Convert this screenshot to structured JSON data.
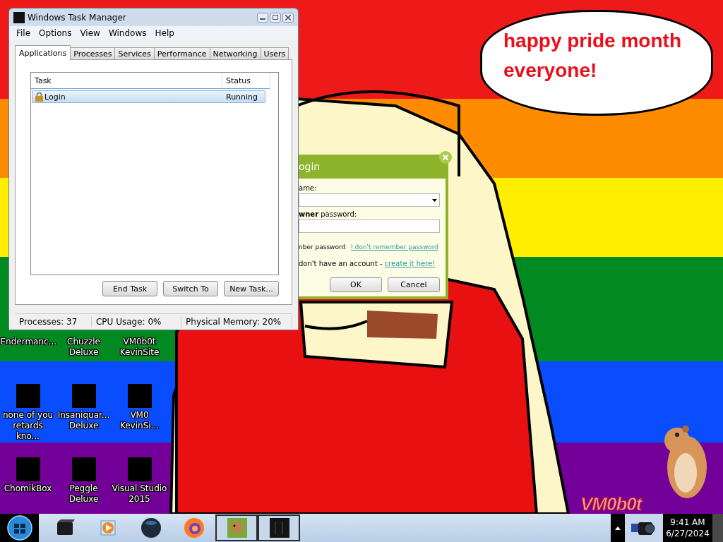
{
  "desktop": {
    "wallpaper": {
      "speech_bubble": "happy pride month everyone!",
      "signature": "VM0b0t"
    },
    "icons": [
      {
        "label": "Endermanc...",
        "kind": "hidden"
      },
      {
        "label": "Chuzzle Deluxe",
        "kind": "hidden"
      },
      {
        "label": "VM0b0t KevinSite",
        "kind": "hidden"
      },
      {
        "label": "none of you retards kno...",
        "kind": "redacted"
      },
      {
        "label": "Insaniquar... Deluxe",
        "kind": "redacted"
      },
      {
        "label": "VM0 KevinSi...",
        "kind": "redacted"
      },
      {
        "label": "ChomikBox",
        "kind": "redacted"
      },
      {
        "label": "Peggle Deluxe",
        "kind": "redacted"
      },
      {
        "label": "Visual Studio 2015",
        "kind": "redacted"
      }
    ]
  },
  "task_manager": {
    "title": "Windows Task Manager",
    "menu": [
      "File",
      "Options",
      "View",
      "Windows",
      "Help"
    ],
    "tabs": [
      {
        "label": "Applications",
        "selected": true
      },
      {
        "label": "Processes",
        "selected": false
      },
      {
        "label": "Services",
        "selected": false
      },
      {
        "label": "Performance",
        "selected": false
      },
      {
        "label": "Networking",
        "selected": false
      },
      {
        "label": "Users",
        "selected": false
      }
    ],
    "columns": [
      "Task",
      "Status"
    ],
    "rows": [
      {
        "task": "Login",
        "status": "Running",
        "selected": true
      }
    ],
    "buttons": [
      "End Task",
      "Switch To",
      "New Task..."
    ],
    "status_bar": [
      "Processes: 37",
      "CPU Usage: 0%",
      "Physical Memory: 20%"
    ]
  },
  "login_dialog": {
    "title": "ogin",
    "name_label": "ame:",
    "password_label": "**wner** password:",
    "remember_label": "nber password",
    "forgot_link": "I don't remember password",
    "account_text": "don't have an account - ",
    "create_link": "create it here!",
    "buttons": [
      "OK",
      "Cancel"
    ]
  },
  "taskbar": {
    "items": [
      {
        "kind": "box",
        "active": false
      },
      {
        "kind": "media",
        "active": false
      },
      {
        "kind": "globe",
        "active": false
      },
      {
        "kind": "firefox",
        "active": false
      },
      {
        "kind": "hamster",
        "active": true
      },
      {
        "kind": "window",
        "active": true
      }
    ],
    "clock": {
      "time": "9:41 AM",
      "date": "6/27/2024"
    }
  }
}
